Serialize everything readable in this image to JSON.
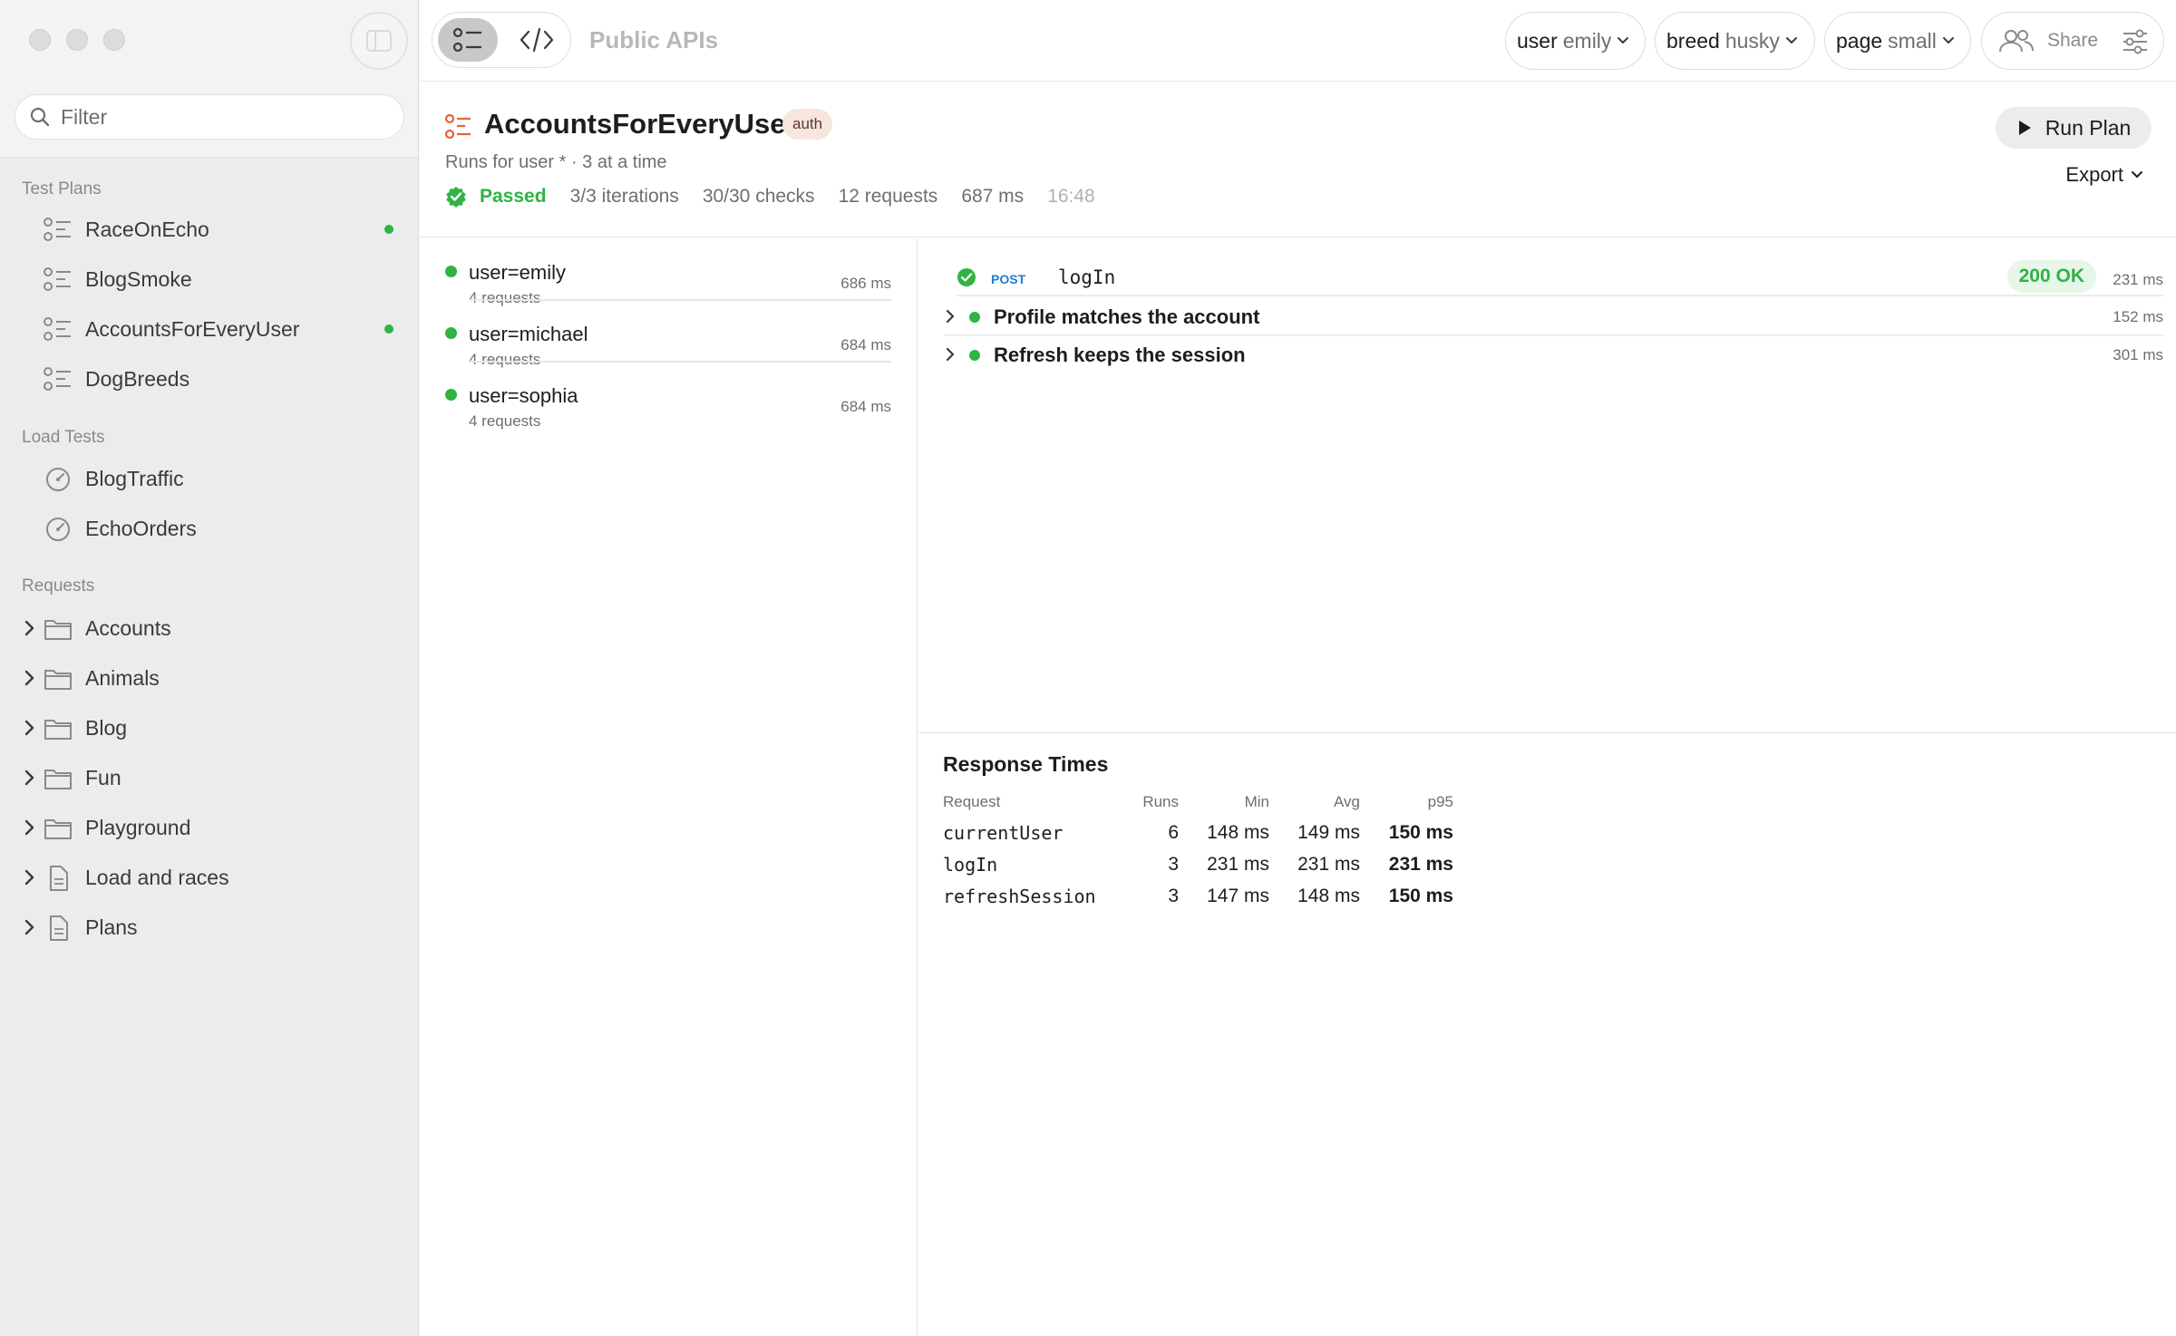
{
  "app": {
    "title": "Public APIs"
  },
  "sidebar": {
    "filter_placeholder": "Filter",
    "sections": {
      "test_plans": "Test Plans",
      "load_tests": "Load Tests",
      "requests": "Requests"
    },
    "test_plans": [
      {
        "label": "RaceOnEcho",
        "active": true
      },
      {
        "label": "BlogSmoke",
        "active": false
      },
      {
        "label": "AccountsForEveryUser",
        "active": true
      },
      {
        "label": "DogBreeds",
        "active": false
      }
    ],
    "load_tests": [
      {
        "label": "BlogTraffic"
      },
      {
        "label": "EchoOrders"
      }
    ],
    "requests": [
      {
        "label": "Accounts",
        "icon": "folder-icon"
      },
      {
        "label": "Animals",
        "icon": "folder-icon"
      },
      {
        "label": "Blog",
        "icon": "folder-icon"
      },
      {
        "label": "Fun",
        "icon": "folder-icon"
      },
      {
        "label": "Playground",
        "icon": "folder-icon"
      },
      {
        "label": "Load and races",
        "icon": "document-icon"
      },
      {
        "label": "Plans",
        "icon": "document-icon"
      }
    ]
  },
  "toolbar": {
    "variables": [
      {
        "key": "user",
        "value": "emily"
      },
      {
        "key": "breed",
        "value": "husky"
      },
      {
        "key": "page",
        "value": "small"
      }
    ],
    "share_label": "Share"
  },
  "plan": {
    "title": "AccountsForEveryUser",
    "tag": "auth",
    "subtitle": "Runs for user * · 3 at a time",
    "status": "Passed",
    "iterations": "3/3 iterations",
    "checks": "30/30 checks",
    "requests": "12 requests",
    "duration": "687 ms",
    "time": "16:48",
    "run_label": "Run Plan",
    "export_label": "Export"
  },
  "iterations": [
    {
      "name": "user=emily",
      "requests": "4 requests",
      "ms": "686 ms"
    },
    {
      "name": "user=michael",
      "requests": "4 requests",
      "ms": "684 ms"
    },
    {
      "name": "user=sophia",
      "requests": "4 requests",
      "ms": "684 ms"
    }
  ],
  "detail": {
    "request": {
      "method": "POST",
      "name": "logIn",
      "status": "200 OK",
      "ms": "231 ms"
    },
    "checks": [
      {
        "name": "Profile matches the account",
        "ms": "152 ms"
      },
      {
        "name": "Refresh keeps the session",
        "ms": "301 ms"
      }
    ]
  },
  "response_times": {
    "title": "Response Times",
    "columns": [
      "Request",
      "Runs",
      "Min",
      "Avg",
      "p95"
    ],
    "rows": [
      {
        "request": "currentUser",
        "runs": "6",
        "min": "148 ms",
        "avg": "149 ms",
        "p95": "150 ms"
      },
      {
        "request": "logIn",
        "runs": "3",
        "min": "231 ms",
        "avg": "231 ms",
        "p95": "231 ms"
      },
      {
        "request": "refreshSession",
        "runs": "3",
        "min": "147 ms",
        "avg": "148 ms",
        "p95": "150 ms"
      }
    ]
  },
  "colors": {
    "accent_green": "#2fb344",
    "method_blue": "#1d7fd4",
    "plan_icon": "#e8623a"
  }
}
